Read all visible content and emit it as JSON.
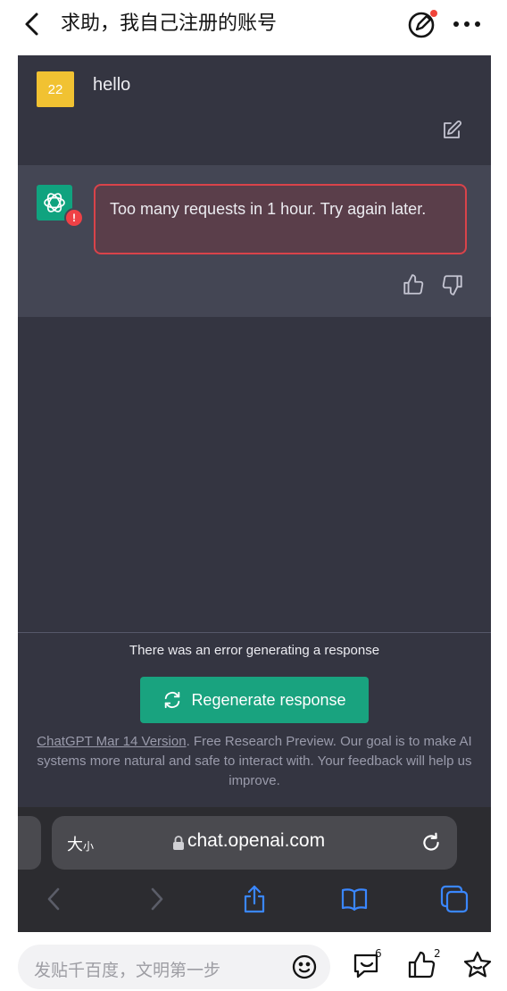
{
  "topbar": {
    "title": "求助，我自己注册的账号"
  },
  "chat": {
    "user_avatar_text": "22",
    "user_message": "hello",
    "error_badge": "!",
    "error_message": "Too many requests in 1 hour. Try again later.",
    "error_generating": "There was an error generating a response",
    "regenerate_label": "Regenerate response",
    "footer_link": "ChatGPT Mar 14 Version",
    "footer_text": ". Free Research Preview. Our goal is to make AI systems more natural and safe to interact with. Your feedback will help us improve."
  },
  "safari": {
    "text_size": "大",
    "text_size_small": "小",
    "url": "chat.openai.com"
  },
  "bottombar": {
    "reply_placeholder": "发贴千百度，文明第一步",
    "comment_count": "6",
    "like_count": "2"
  },
  "colors": {
    "chat_bg": "#343541",
    "bot_row_bg": "#444654",
    "accent_green": "#19a37f",
    "error_red": "#d9434a",
    "notification_dot": "#f0443a"
  },
  "icons": [
    "back-arrow-icon",
    "edit-post-icon",
    "more-icon",
    "edit-message-icon",
    "openai-logo-icon",
    "thumbs-up-icon",
    "thumbs-down-icon",
    "regenerate-icon",
    "lock-icon",
    "reload-icon",
    "nav-back-icon",
    "nav-forward-icon",
    "share-icon",
    "bookmarks-icon",
    "tabs-icon",
    "smile-icon",
    "comment-icon",
    "like-icon",
    "star-icon"
  ]
}
